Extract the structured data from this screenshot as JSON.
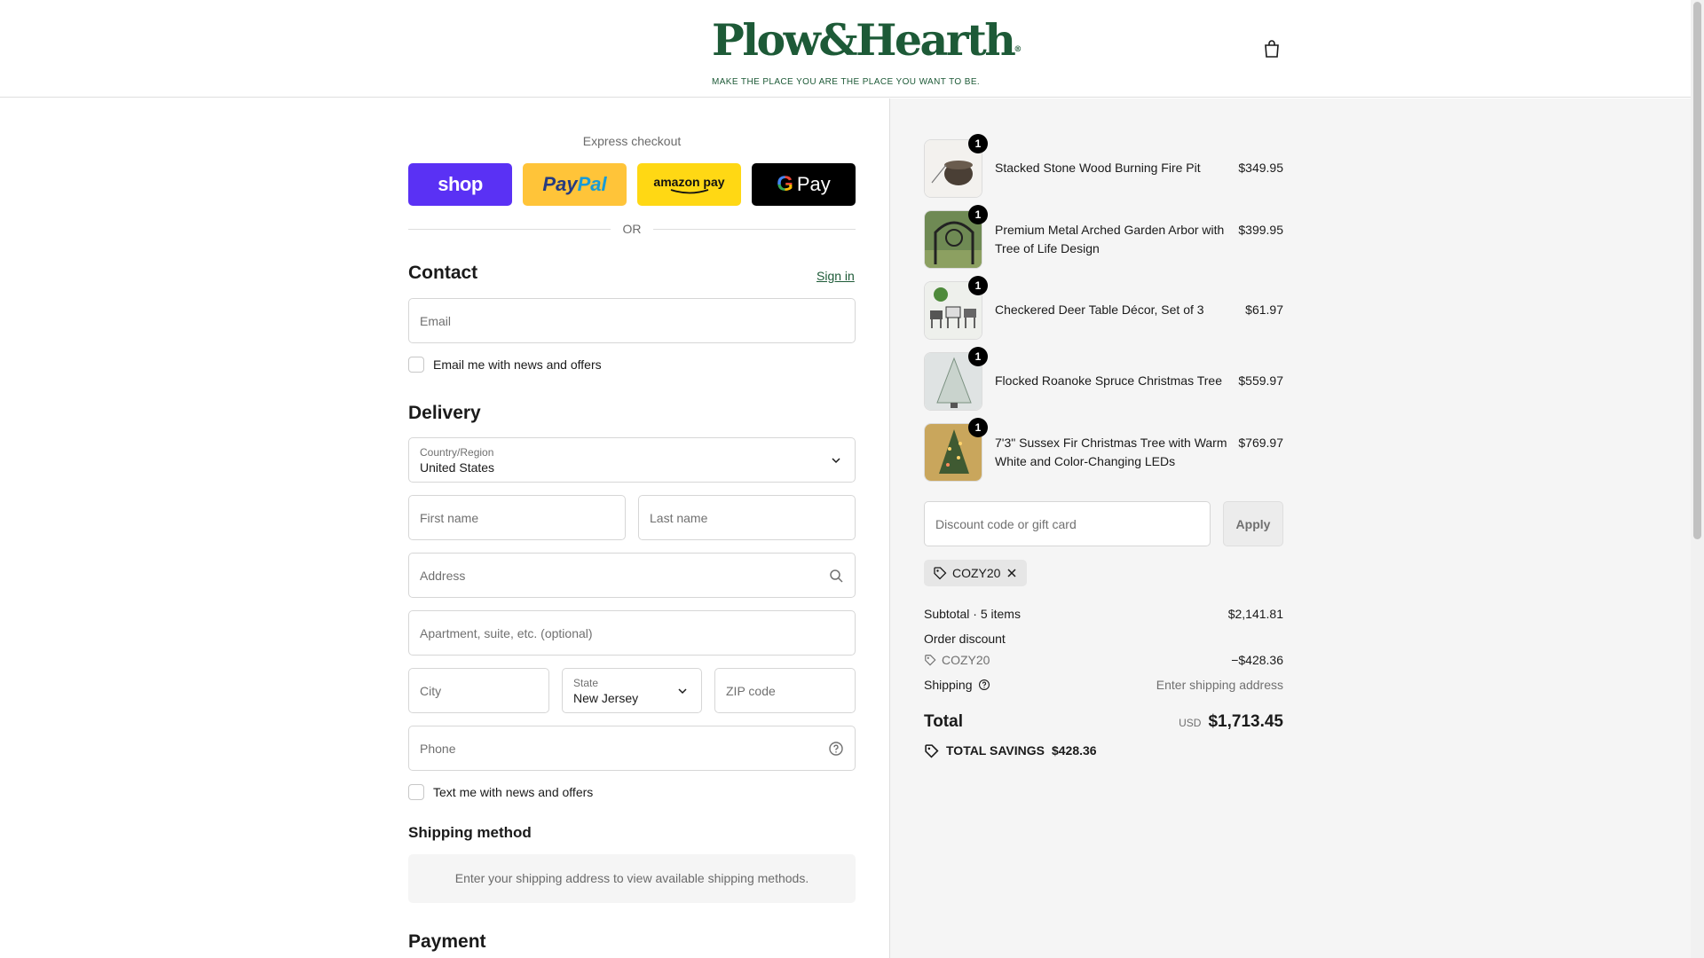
{
  "header": {
    "logo_text": "Plow&Hearth",
    "logo_reg": "®",
    "tagline": "MAKE THE PLACE YOU ARE THE PLACE YOU WANT TO BE."
  },
  "express": {
    "label": "Express checkout",
    "shop": "shop",
    "paypal_1": "Pay",
    "paypal_2": "Pal",
    "amazon": "amazon pay",
    "gpay_g": "G",
    "gpay": "Pay",
    "or": "OR"
  },
  "contact": {
    "title": "Contact",
    "sign_in": "Sign in",
    "email_placeholder": "Email",
    "newsletter": "Email me with news and offers"
  },
  "delivery": {
    "title": "Delivery",
    "country_label": "Country/Region",
    "country_value": "United States",
    "first_name": "First name",
    "last_name": "Last name",
    "address": "Address",
    "apartment": "Apartment, suite, etc. (optional)",
    "city": "City",
    "state_label": "State",
    "state_value": "New Jersey",
    "zip": "ZIP code",
    "phone": "Phone",
    "text_offers": "Text me with news and offers"
  },
  "shipping_method": {
    "title": "Shipping method",
    "message": "Enter your shipping address to view available shipping methods."
  },
  "payment": {
    "title": "Payment"
  },
  "cart": {
    "items": [
      {
        "name": "Stacked Stone Wood Burning Fire Pit",
        "price": "$349.95",
        "qty": "1"
      },
      {
        "name": "Premium Metal Arched Garden Arbor with Tree of Life Design",
        "price": "$399.95",
        "qty": "1"
      },
      {
        "name": "Checkered Deer Table Décor, Set of 3",
        "price": "$61.97",
        "qty": "1"
      },
      {
        "name": "Flocked Roanoke Spruce Christmas Tree",
        "price": "$559.97",
        "qty": "1"
      },
      {
        "name": "7'3\" Sussex Fir Christmas Tree with Warm White and Color-Changing LEDs",
        "price": "$769.97",
        "qty": "1"
      }
    ],
    "discount_placeholder": "Discount code or gift card",
    "apply": "Apply",
    "applied_code": "COZY20"
  },
  "summary": {
    "subtotal_label": "Subtotal · 5 items",
    "subtotal_value": "$2,141.81",
    "order_discount_label": "Order discount",
    "discount_code": "COZY20",
    "discount_value": "−$428.36",
    "shipping_label": "Shipping",
    "shipping_value": "Enter shipping address",
    "total_label": "Total",
    "currency": "USD",
    "total_value": "$1,713.45",
    "savings_label": "TOTAL SAVINGS",
    "savings_value": "$428.36"
  },
  "colors": {
    "brand_green": "#1d5a37",
    "shop_purple": "#5a31f4",
    "paypal_yellow": "#ffc439",
    "amazon_yellow": "#ffd814"
  }
}
